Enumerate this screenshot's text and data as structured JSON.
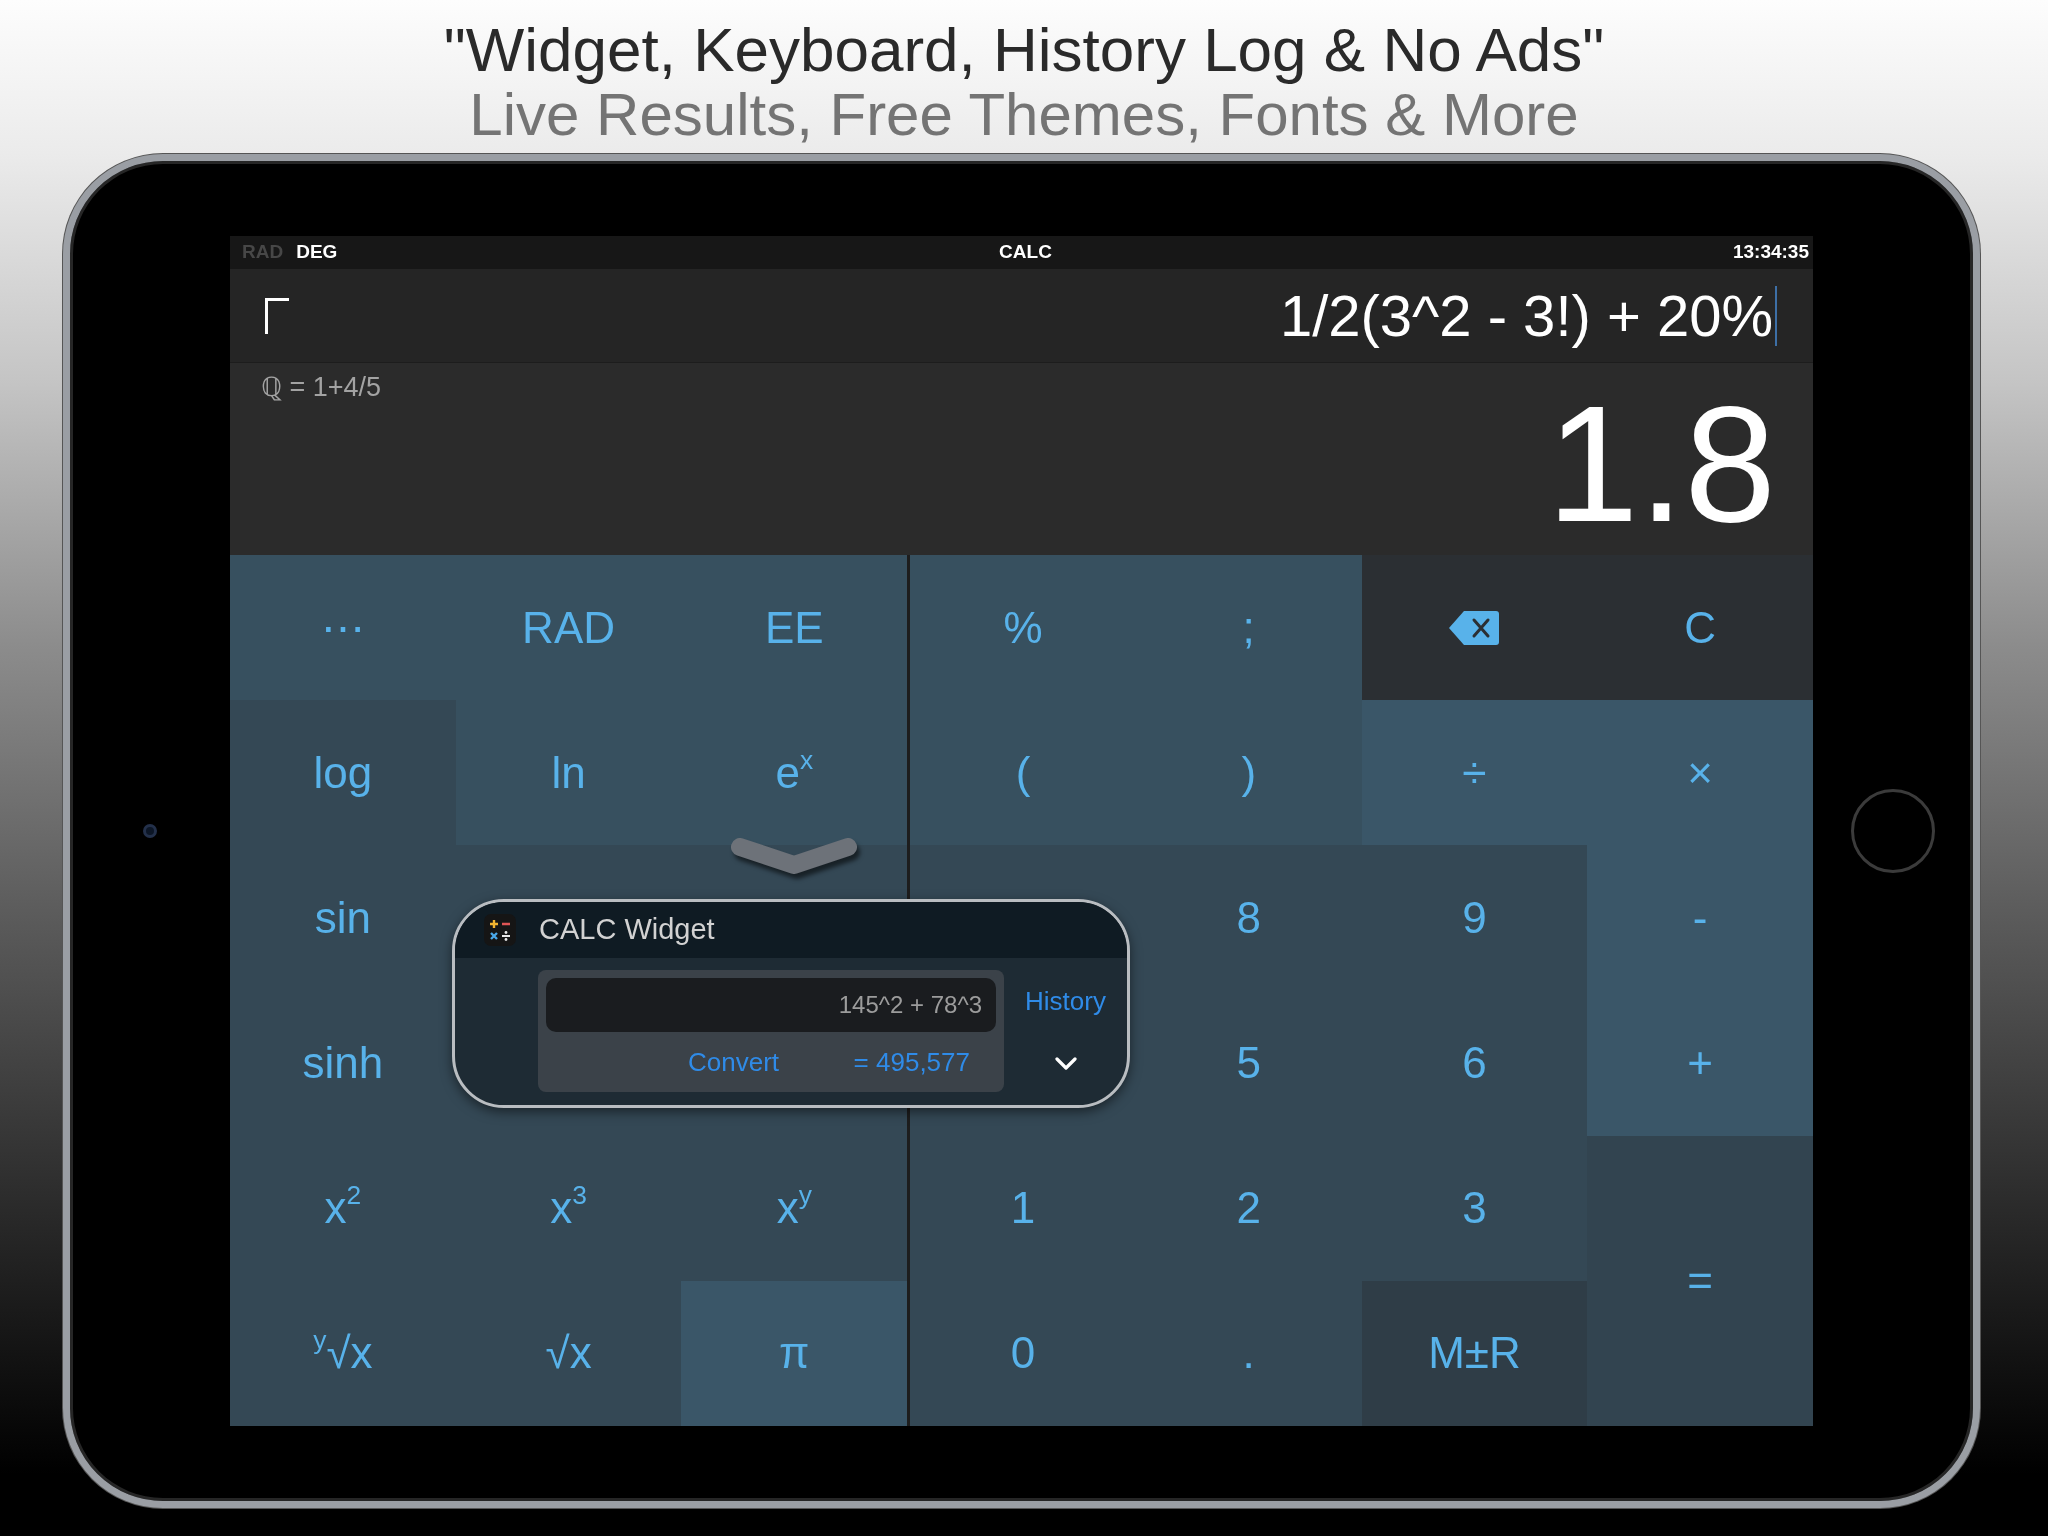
{
  "header": {
    "headline": "\"Widget, Keyboard, History Log & No Ads\"",
    "subheadline": "Live Results, Free Themes, Fonts & More"
  },
  "status_bar": {
    "modes": [
      {
        "label": "RAD",
        "selected": false
      },
      {
        "label": "DEG",
        "selected": true
      }
    ],
    "title": "CALC",
    "time": "13:34:35"
  },
  "display": {
    "expression": "1/2(3^2 - 3!) + 20%",
    "fraction": "ℚ = 1+4/5",
    "result": "1.8"
  },
  "keypad": {
    "rows": [
      [
        {
          "label": "⋯",
          "kind": "upper"
        },
        {
          "label": "RAD",
          "kind": "upper"
        },
        {
          "label": "EE",
          "kind": "upper"
        },
        {
          "label": "%",
          "kind": "upper"
        },
        {
          "label": ";",
          "kind": "upper"
        },
        {
          "kind": "delete"
        },
        {
          "label": "C",
          "kind": "dark"
        }
      ],
      [
        {
          "label": "log",
          "kind": "lower"
        },
        {
          "label": "ln",
          "kind": "upper"
        },
        {
          "label": "e$^{x}$",
          "kind": "upper"
        },
        {
          "label": "(",
          "kind": "upper"
        },
        {
          "label": ")",
          "kind": "upper"
        },
        {
          "label": "÷",
          "kind": "accent"
        },
        {
          "label": "×",
          "kind": "accent"
        }
      ],
      [
        {
          "label": "sin",
          "kind": "lower"
        },
        {
          "kind": "covered"
        },
        {
          "kind": "covered"
        },
        {
          "kind": "covered"
        },
        {
          "label": "8",
          "kind": "lower"
        },
        {
          "label": "9",
          "kind": "lower"
        },
        {
          "label": "-",
          "kind": "accent"
        }
      ],
      [
        {
          "label": "sinh",
          "kind": "lower"
        },
        {
          "kind": "covered"
        },
        {
          "kind": "covered"
        },
        {
          "kind": "covered"
        },
        {
          "label": "5",
          "kind": "lower"
        },
        {
          "label": "6",
          "kind": "lower"
        },
        {
          "label": "+",
          "kind": "accent"
        }
      ],
      [
        {
          "label": "x$^{2}$",
          "kind": "lower"
        },
        {
          "label": "x$^{3}$",
          "kind": "lower"
        },
        {
          "label": "x$^{y}$",
          "kind": "lower"
        },
        {
          "label": "1",
          "kind": "lower"
        },
        {
          "label": "2",
          "kind": "lower"
        },
        {
          "label": "3",
          "kind": "lower"
        },
        {
          "label": "=",
          "kind": "equals"
        }
      ],
      [
        {
          "label": "$^{y}$√x",
          "kind": "lower"
        },
        {
          "label": "√x",
          "kind": "lower"
        },
        {
          "label": "π",
          "kind": "accent"
        },
        {
          "label": "0",
          "kind": "lower"
        },
        {
          "label": ".",
          "kind": "lower"
        },
        {
          "label": "M±R",
          "kind": "memory"
        }
      ]
    ]
  },
  "widget": {
    "title": "CALC Widget",
    "input": {
      "value": "145^2 + 78^3"
    },
    "convert": "Convert",
    "answer": "= 495,577",
    "history": "History"
  }
}
